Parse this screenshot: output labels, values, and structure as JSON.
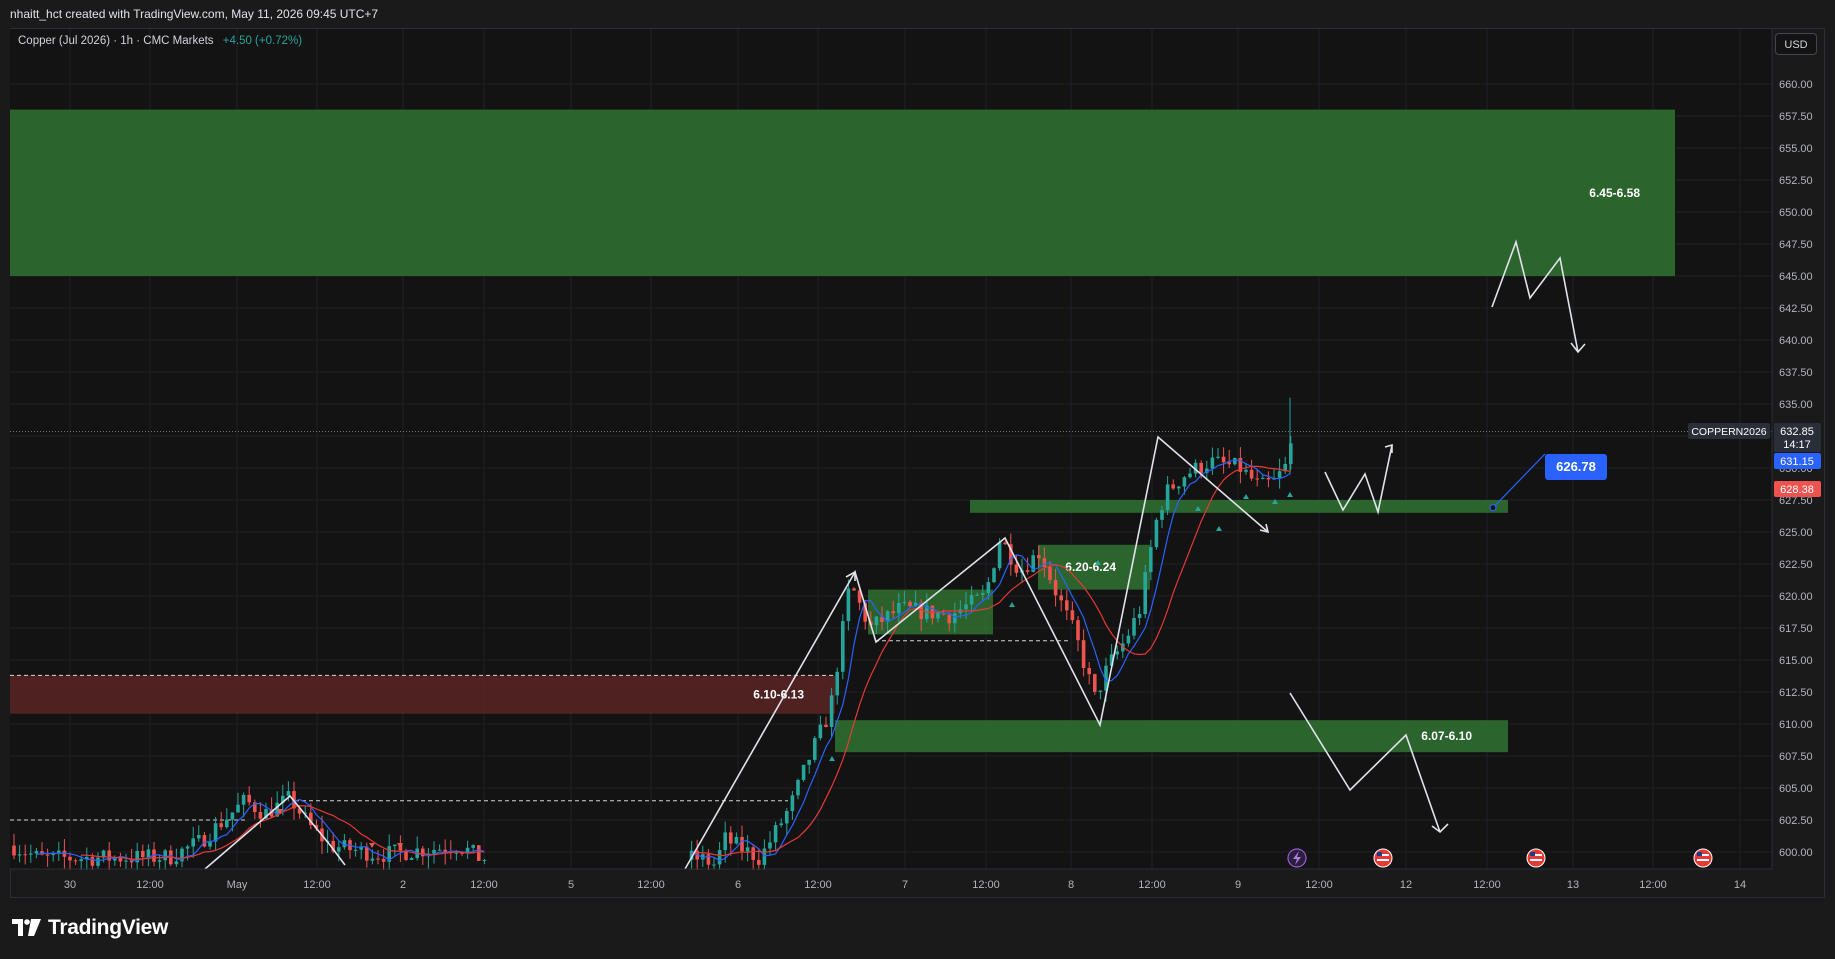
{
  "header": {
    "attribution": "nhaitt_hct created with TradingView.com, May 11, 2026 09:45 UTC+7"
  },
  "legend": {
    "symbol": "Copper (Jul 2026) · 1h · CMC Markets",
    "change": "+4.50 (+0.72%)"
  },
  "currency_button": "USD",
  "brand": "TradingView",
  "colors": {
    "background": "#131313",
    "green_zone": "#2f6b30",
    "red_zone": "#5a2424",
    "up_candle": "#26a69a",
    "down_candle": "#ef5350",
    "ma_fast": "#2962ff",
    "ma_slow": "#e53935",
    "annotation": "#e0e3eb"
  },
  "chart_data": {
    "type": "candlestick",
    "symbol": "COPPERN2026",
    "timeframe": "1h",
    "y_axis": {
      "range": [
        598.5,
        661.5
      ],
      "ticks": [
        "600.00",
        "602.50",
        "605.00",
        "607.50",
        "610.00",
        "612.50",
        "615.00",
        "617.50",
        "620.00",
        "622.50",
        "625.00",
        "627.50",
        "630.00",
        "632.50",
        "635.00",
        "637.50",
        "640.00",
        "642.50",
        "645.00",
        "647.50",
        "650.00",
        "652.50",
        "655.00",
        "657.50",
        "660.00"
      ]
    },
    "x_axis": {
      "ticks": [
        "30",
        "12:00",
        "May",
        "12:00",
        "2",
        "12:00",
        "5",
        "12:00",
        "6",
        "12:00",
        "7",
        "12:00",
        "8",
        "12:00",
        "9",
        "12:00",
        "12",
        "12:00",
        "13",
        "12:00",
        "14"
      ]
    },
    "price_labels": [
      {
        "label": "COPPERN2026",
        "value": 632.85,
        "color": "#2a2e39"
      },
      {
        "label": "14:17",
        "value": 631.75,
        "color": "#2a2e39"
      },
      {
        "label": "631.15",
        "value": 631.15,
        "color": "#2962ff"
      },
      {
        "label": "628.38",
        "value": 628.38,
        "color": "#ef5350"
      }
    ],
    "zones": [
      {
        "label": "6.45-6.58",
        "low": 645.0,
        "high": 658.0,
        "kind": "supply-target"
      },
      {
        "label": "6.20-6.24",
        "low": 620.5,
        "high": 624.0,
        "kind": "demand"
      },
      {
        "label": "6.10-6.13",
        "low": 610.8,
        "high": 613.8,
        "kind": "resistance"
      },
      {
        "label": "6.07-6.10",
        "low": 607.8,
        "high": 610.3,
        "kind": "demand"
      },
      {
        "label": "",
        "low": 626.5,
        "high": 627.5,
        "kind": "support"
      }
    ],
    "price_marker": {
      "label": "626.78",
      "value": 626.78
    },
    "series": [
      {
        "name": "Copper (Jul 2026)",
        "kind": "candles",
        "period": "1h",
        "segments": [
          {
            "session": "Apr 30 – May 2",
            "range": [
              598.8,
              605.0
            ]
          },
          {
            "session": "May 6",
            "range": [
              599.0,
              622.0
            ]
          },
          {
            "session": "May 7",
            "range": [
              615.8,
              624.0
            ]
          },
          {
            "session": "May 8",
            "range": [
              610.0,
              625.0
            ]
          },
          {
            "session": "May 9–11",
            "range": [
              625.0,
              635.5
            ]
          }
        ],
        "last_close": 632.85
      },
      {
        "name": "",
        "kind": "moving-average"
      },
      {
        "name": "",
        "kind": "moving-average"
      }
    ]
  }
}
